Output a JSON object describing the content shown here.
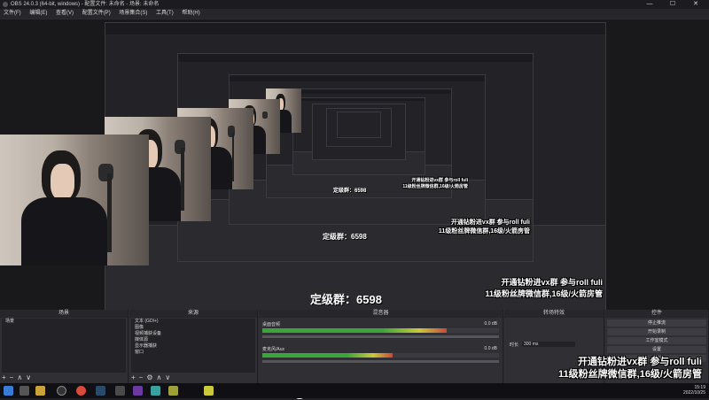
{
  "window": {
    "title": "OBS 24.0.3 (64-bit, windows) - 配置文件: 未命名 - 场景: 未命名",
    "controls": [
      "—",
      "☐",
      "✕"
    ]
  },
  "menu": [
    "文件(F)",
    "编辑(E)",
    "查看(V)",
    "配置文件(P)",
    "场景集合(S)",
    "工具(T)",
    "帮助(H)"
  ],
  "overlay": {
    "line1": "开通钻粉进vx群 参与roll fuli",
    "line2": "11级粉丝牌微信群,16级/火箭房管",
    "group": "定级群：6598"
  },
  "docks": {
    "scenes": {
      "title": "场景",
      "items": [
        "场景"
      ]
    },
    "sources": {
      "title": "来源",
      "items": [
        "文本 (GDI+)",
        "图像",
        "视频捕获设备",
        "媒体源",
        "显示器捕获",
        "窗口"
      ]
    },
    "mixer": {
      "title": "混音器",
      "channels": [
        {
          "name": "桌面音频",
          "db": "0.0 dB",
          "level": 0.78
        },
        {
          "name": "麦克风/Aux",
          "db": "0.0 dB",
          "level": 0.55
        }
      ]
    },
    "transitions": {
      "title": "转场特效",
      "duration_label": "时长",
      "duration": "300 ms"
    },
    "controls": {
      "title": "控件",
      "buttons": [
        "停止推流",
        "开始录制",
        "工作室模式",
        "设置",
        "退出"
      ]
    }
  },
  "taskbar": {
    "time": "15:19",
    "date": "2022/10/25",
    "icons": [
      "start",
      "search",
      "file-explorer",
      "obs",
      "chrome",
      "steam",
      "app",
      "app",
      "app",
      "app"
    ]
  }
}
